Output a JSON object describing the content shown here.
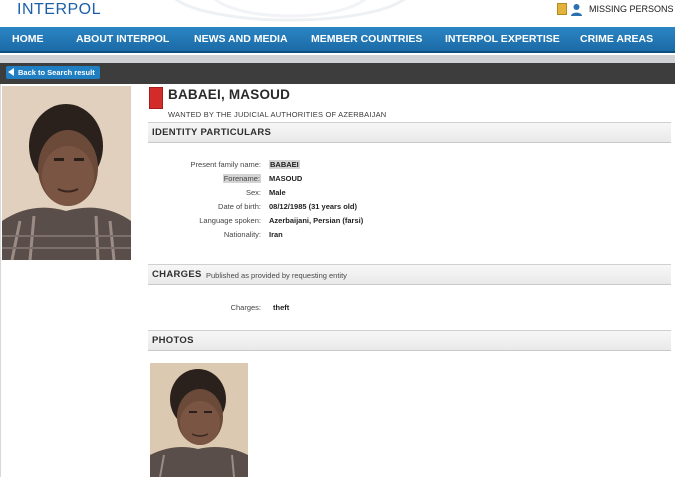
{
  "header": {
    "logo": "INTERPOL",
    "missing_persons": "MISSING PERSONS"
  },
  "nav": {
    "items": [
      "HOME",
      "ABOUT INTERPOL",
      "NEWS AND MEDIA",
      "MEMBER COUNTRIES",
      "INTERPOL EXPERTISE",
      "CRIME AREAS"
    ]
  },
  "back_button": "Back to Search result",
  "person": {
    "name": "BABAEI, MASOUD",
    "wanted_by": "WANTED BY THE JUDICIAL AUTHORITIES OF AZERBAIJAN"
  },
  "identity": {
    "title": "IDENTITY PARTICULARS",
    "fields": [
      {
        "label": "Present family name:",
        "value": "BABAEI"
      },
      {
        "label": "Forename:",
        "value": "MASOUD"
      },
      {
        "label": "Sex:",
        "value": "Male"
      },
      {
        "label": "Date of birth:",
        "value": "08/12/1985 (31 years old)"
      },
      {
        "label": "Language spoken:",
        "value": "Azerbaijani, Persian (farsi)"
      },
      {
        "label": "Nationality:",
        "value": "Iran"
      }
    ]
  },
  "charges": {
    "title": "CHARGES",
    "subtitle": "Published as provided by requesting entity",
    "label": "Charges:",
    "value": "theft"
  },
  "photos": {
    "title": "PHOTOS"
  },
  "colors": {
    "nav_blue": "#1f77b8",
    "logo_blue": "#1c5fa8",
    "dark_bar": "#3d3d3d",
    "button_blue": "#1f7fc2",
    "notice_red": "#d32a2a"
  }
}
